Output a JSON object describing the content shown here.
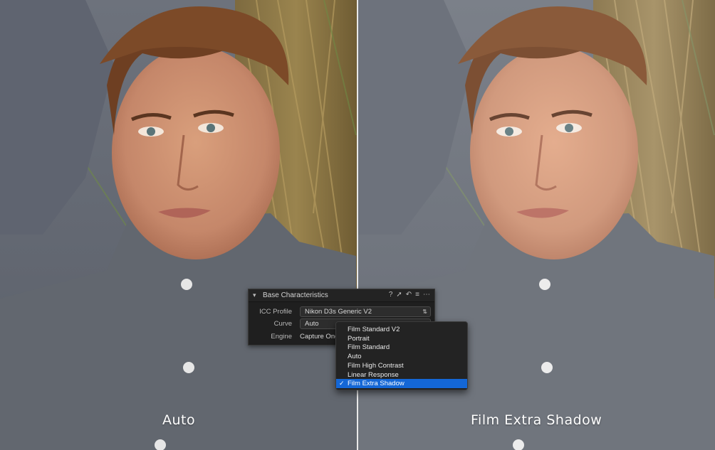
{
  "captions": {
    "left": "Auto",
    "right": "Film Extra Shadow"
  },
  "panel": {
    "title": "Base Characteristics",
    "icons": [
      "question-icon",
      "eyedropper-icon",
      "reset-icon",
      "menu-lines-icon",
      "more-icon"
    ],
    "rows": [
      {
        "label": "ICC Profile",
        "value": "Nikon D3s Generic V2"
      },
      {
        "label": "Curve",
        "value": "Auto"
      },
      {
        "label": "Engine",
        "value": "Capture One"
      }
    ]
  },
  "curve_menu": {
    "options": [
      "Film Standard V2",
      "Portrait",
      "Film Standard",
      "Auto",
      "Film High Contrast",
      "Linear Response",
      "Film Extra Shadow"
    ],
    "selected": "Film Extra Shadow"
  },
  "colors": {
    "selection": "#1467d6",
    "panel_bg": "#1f1f1f",
    "divider": "#e9e9e9"
  }
}
